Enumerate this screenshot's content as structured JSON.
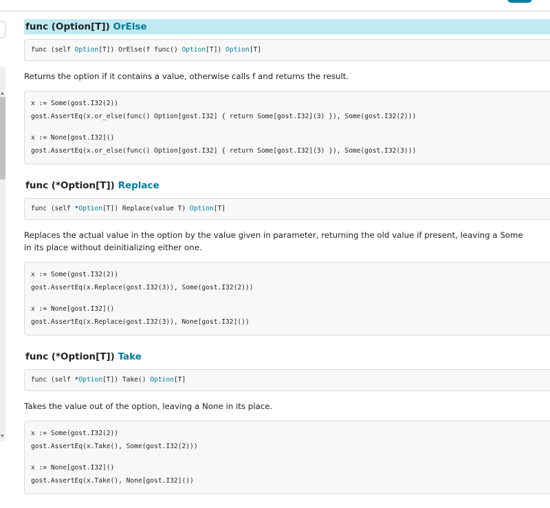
{
  "sections": [
    {
      "recv": "func (Option[T]) ",
      "name": "OrElse",
      "sig": [
        [
          "func (self ",
          false
        ],
        [
          "Option",
          true
        ],
        [
          "[T]) OrElse(f func() ",
          false
        ],
        [
          "Option",
          true
        ],
        [
          "[T]) ",
          false
        ],
        [
          "Option",
          true
        ],
        [
          "[T]",
          false
        ]
      ],
      "desc": "Returns the option if it contains a value, otherwise calls f and returns the result.",
      "code": [
        "x := Some(gost.I32(2))",
        "gost.AssertEq(x.or_else(func() Option[gost.I32] { return Some[gost.I32](3) }), Some(gost.I32(2)))",
        "",
        "x := None[gost.I32]()",
        "gost.AssertEq(x.or_else(func() Option[gost.I32] { return Some[gost.I32](3) }), Some(gost.I32(3)))"
      ]
    },
    {
      "recv": "func (*Option[T]) ",
      "name": "Replace",
      "sig": [
        [
          "func (self *",
          false
        ],
        [
          "Option",
          true
        ],
        [
          "[T]) Replace(value T) ",
          false
        ],
        [
          "Option",
          true
        ],
        [
          "[T]",
          false
        ]
      ],
      "desc": "Replaces the actual value in the option by the value given in parameter, returning the old value if present, leaving a Some in its place without deinitializing either one.",
      "code": [
        "x := Some(gost.I32(2))",
        "gost.AssertEq(x.Replace(gost.I32(3)), Some(gost.I32(2)))",
        "",
        "x := None[gost.I32]()",
        "gost.AssertEq(x.Replace(gost.I32(3)), None[gost.I32]())"
      ]
    },
    {
      "recv": "func (*Option[T]) ",
      "name": "Take",
      "sig": [
        [
          "func (self *",
          false
        ],
        [
          "Option",
          true
        ],
        [
          "[T]) Take() ",
          false
        ],
        [
          "Option",
          true
        ],
        [
          "[T]",
          false
        ]
      ],
      "desc": "Takes the value out of the option, leaving a None in its place.",
      "code": [
        "x := Some(gost.I32(2))",
        "gost.AssertEq(x.Take(), Some(gost.I32(2)))",
        "",
        "x := None[gost.I32]()",
        "gost.AssertEq(x.Take(), None[gost.I32]())"
      ]
    }
  ],
  "colors": {
    "link": "#007d9c",
    "highlight": "#c0eaf2"
  }
}
